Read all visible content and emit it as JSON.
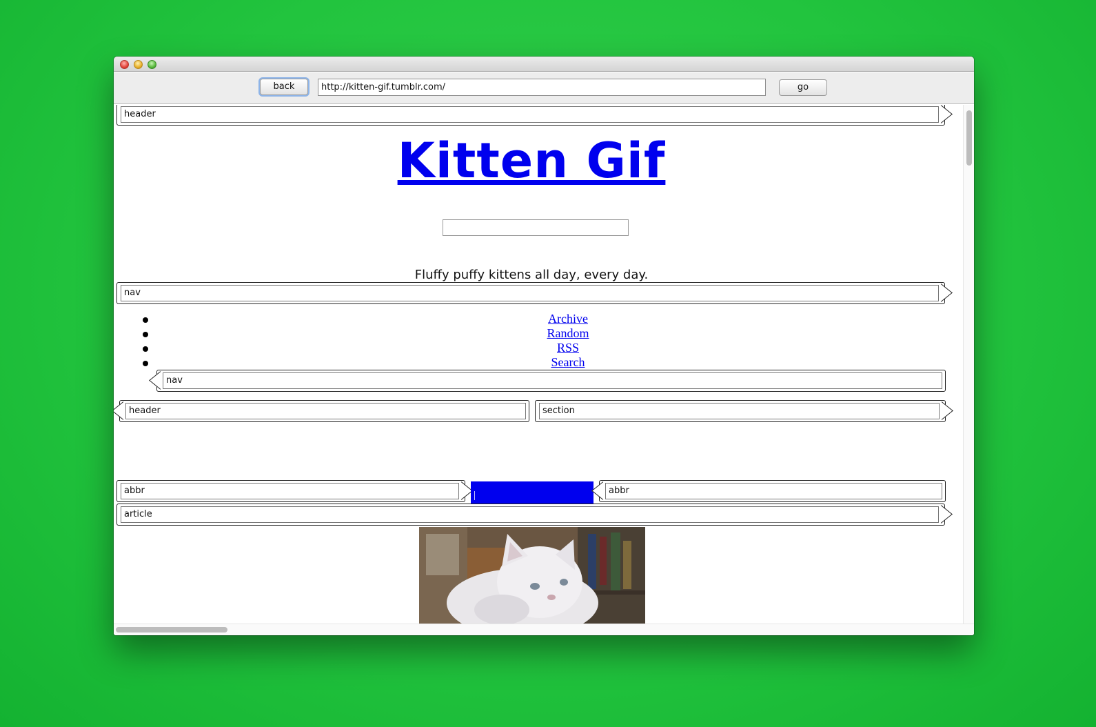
{
  "window": {
    "controls": [
      "close",
      "minimize",
      "zoom"
    ]
  },
  "toolbar": {
    "back_label": "back",
    "url": "http://kitten-gif.tumblr.com/",
    "go_label": "go"
  },
  "tags": {
    "header_top": "header",
    "nav_main": "nav",
    "nav_inner": "nav",
    "header_second": "header",
    "section": "section",
    "abbr_left": "abbr",
    "abbr_right": "abbr",
    "article": "article"
  },
  "site": {
    "title": "Kitten Gif",
    "search_value": "",
    "tagline": "Fluffy puffy kittens all day, every day."
  },
  "nav": {
    "links": [
      "Archive",
      "Random",
      "RSS",
      "Search"
    ]
  },
  "pager": {
    "left_text": "",
    "separator": "|",
    "right_text": ""
  },
  "colors": {
    "background": "#22c43e",
    "link": "#0000ee",
    "pager_bg": "#0000ee"
  }
}
